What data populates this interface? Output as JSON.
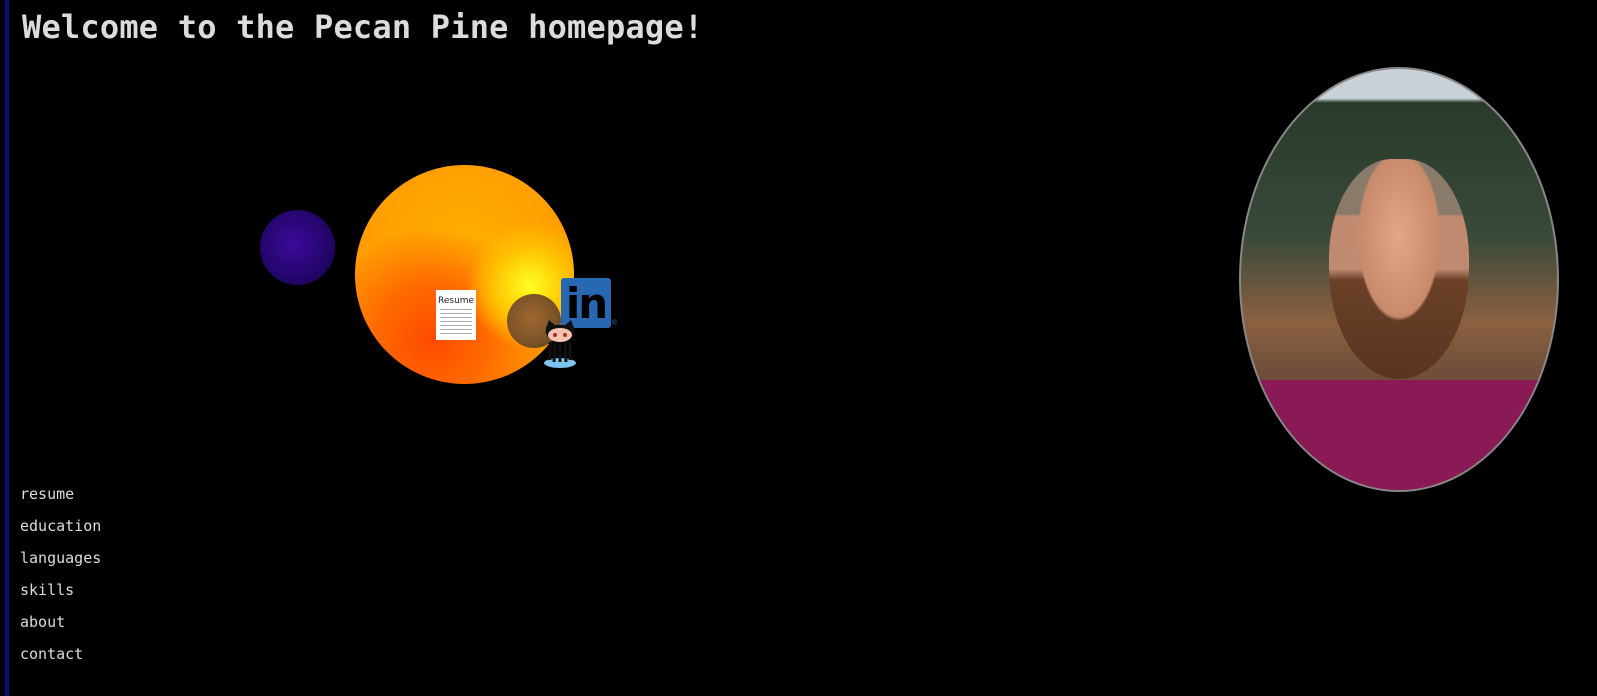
{
  "header": {
    "title": "Welcome to the Pecan Pine homepage!"
  },
  "solar_system": {
    "resume_icon_label": "Resume",
    "linkedin_label": "in",
    "linkedin_registered": "®"
  },
  "nav": {
    "items": [
      {
        "label": "resume"
      },
      {
        "label": "education"
      },
      {
        "label": "languages"
      },
      {
        "label": "skills"
      },
      {
        "label": "about"
      },
      {
        "label": "contact"
      }
    ]
  },
  "colors": {
    "background": "#000000",
    "left_bar": "#0a0a7a",
    "text": "#dcdcdc",
    "linkedin": "#2867b2"
  }
}
